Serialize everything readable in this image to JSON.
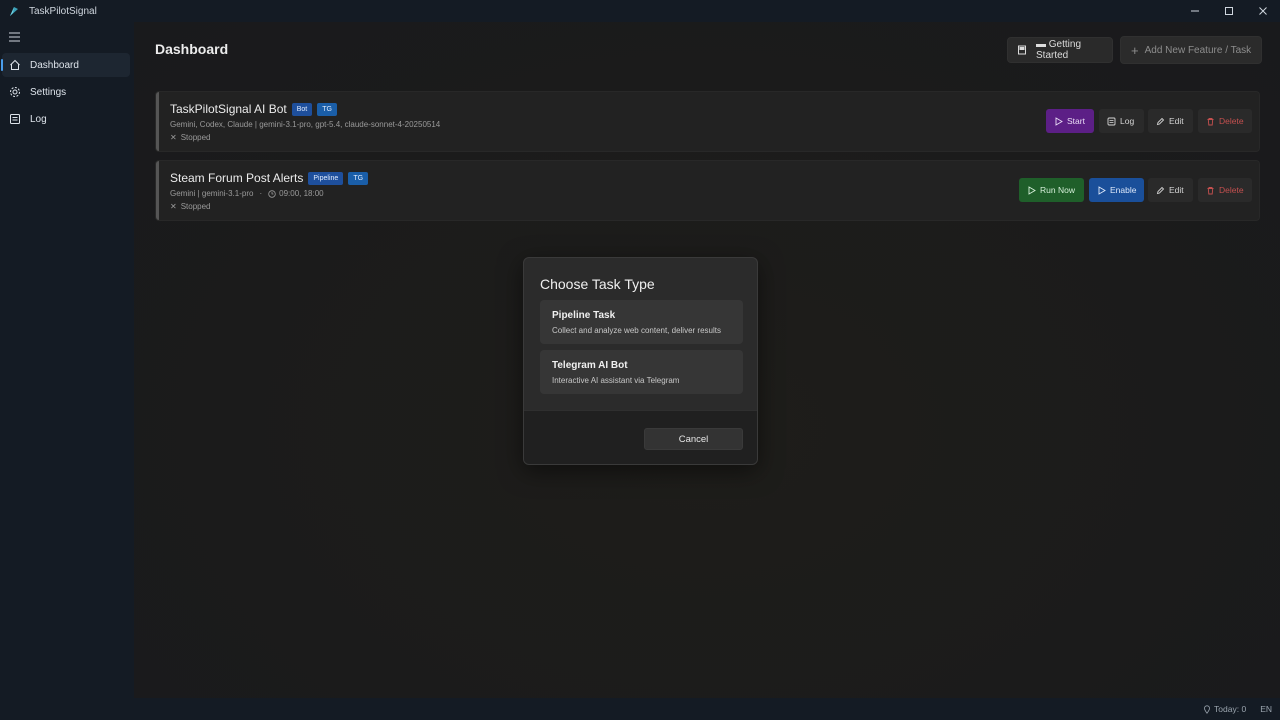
{
  "app": {
    "title": "TaskPilotSignal"
  },
  "sidebar": {
    "items": [
      {
        "label": "Dashboard",
        "icon": "home-icon"
      },
      {
        "label": "Settings",
        "icon": "gear-icon"
      },
      {
        "label": "Log",
        "icon": "log-icon"
      }
    ]
  },
  "header": {
    "title": "Dashboard",
    "getting_started": "Getting Started",
    "add_new": "Add New Feature / Task"
  },
  "tasks": [
    {
      "name": "TaskPilotSignal AI Bot",
      "badges": [
        "Bot",
        "TG"
      ],
      "models": "Gemini, Codex, Claude | gemini-3.1-pro, gpt-5.4, claude-sonnet-4-20250514",
      "status": "Stopped",
      "actions": [
        "Start",
        "Log",
        "Edit",
        "Delete"
      ]
    },
    {
      "name": "Steam Forum Post Alerts",
      "badges": [
        "Pipeline",
        "TG"
      ],
      "models": "Gemini | gemini-3.1-pro",
      "schedule": "09:00, 18:00",
      "status": "Stopped",
      "actions": [
        "Run Now",
        "Enable",
        "Edit",
        "Delete"
      ]
    }
  ],
  "dialog": {
    "title": "Choose Task Type",
    "options": [
      {
        "title": "Pipeline Task",
        "desc": "Collect and analyze web content, deliver results"
      },
      {
        "title": "Telegram AI Bot",
        "desc": "Interactive AI assistant via Telegram"
      }
    ],
    "cancel": "Cancel"
  },
  "statusbar": {
    "today": "Today: 0",
    "lang": "EN"
  },
  "colors": {
    "accent": "#4a9eed",
    "start": "#5c1f86",
    "run": "#1f5f2a",
    "enable": "#1a4f9a",
    "delete": "#c4504f"
  }
}
